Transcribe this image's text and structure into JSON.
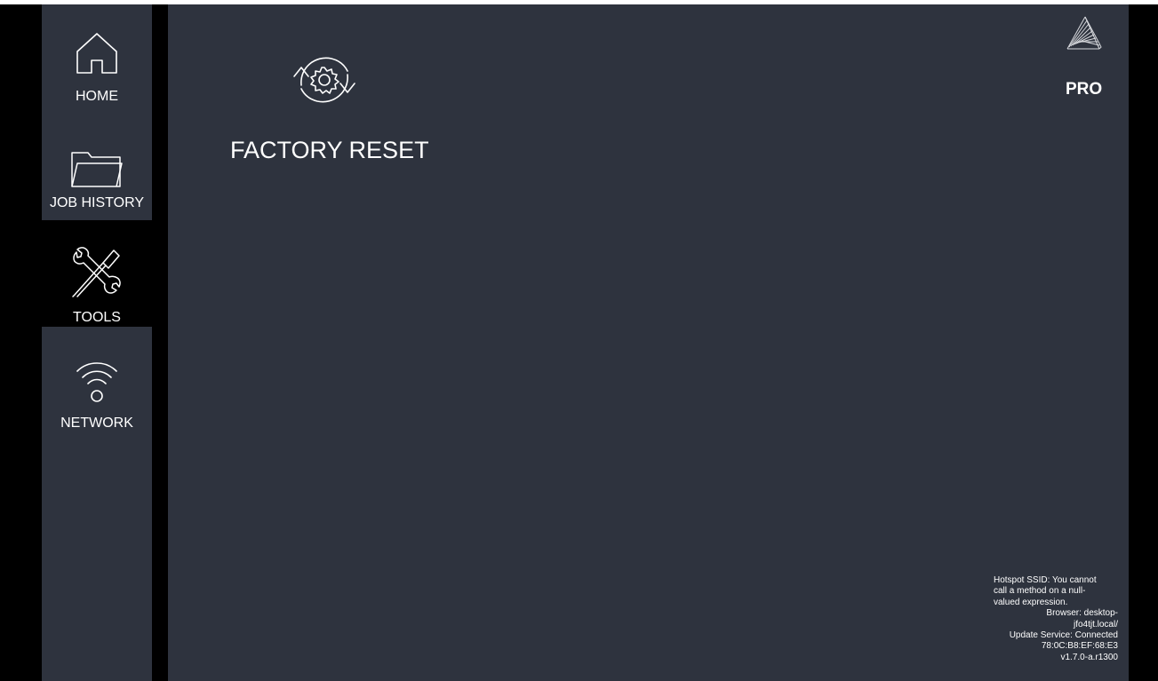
{
  "nav": {
    "items": [
      {
        "label": "HOME",
        "icon": "home-icon",
        "active": false
      },
      {
        "label": "JOB HISTORY",
        "icon": "folder-icon",
        "active": false
      },
      {
        "label": "TOOLS",
        "icon": "tools-icon",
        "active": true
      },
      {
        "label": "NETWORK",
        "icon": "wifi-icon",
        "active": false
      }
    ]
  },
  "tools": {
    "items": [
      {
        "label": "FACTORY RESET",
        "icon": "factory-reset-icon"
      }
    ]
  },
  "brand": {
    "badge": "PRO",
    "logo_icon": "brand-logo-icon"
  },
  "status": {
    "hotspot_line1": "Hotspot SSID: You cannot",
    "hotspot_line2": "call a method on a null-",
    "hotspot_line3": "valued expression.",
    "browser_line1": "Browser: desktop-",
    "browser_line2": "jfo4tjt.local/",
    "update_service": "Update Service: Connected",
    "mac": "78:0C:B8:EF:68:E3",
    "version": "v1.7.0-a.r1300"
  },
  "colors": {
    "panel": "#2e333e",
    "frame": "#000000",
    "text": "#ffffff"
  }
}
